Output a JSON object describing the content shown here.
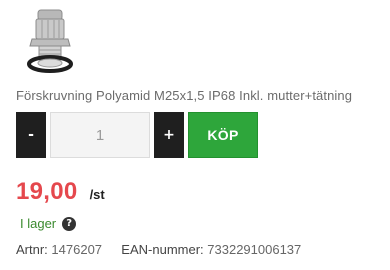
{
  "product": {
    "image_icon": "cable-gland-icon",
    "title": "Förskruvning Polyamid M25x1,5 IP68 Inkl. mutter+tätning"
  },
  "quantity": {
    "minus_label": "-",
    "value": "1",
    "plus_label": "+",
    "buy_label": "KÖP"
  },
  "price": {
    "value": "19,00",
    "unit": "/st"
  },
  "stock": {
    "status": "I lager",
    "help_icon": "?"
  },
  "meta": {
    "artnr_label": "Artnr:",
    "artnr_value": "1476207",
    "ean_label": "EAN-nummer:",
    "ean_value": "7332291006137"
  },
  "colors": {
    "buy_button": "#2ea63b",
    "price": "#e5484d",
    "stock": "#3a8a2e",
    "step_buttons": "#1f1f1f"
  }
}
